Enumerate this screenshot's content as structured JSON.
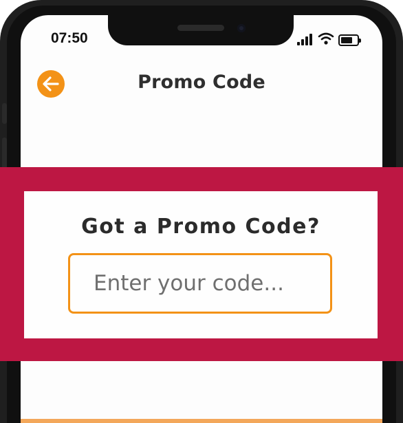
{
  "status_bar": {
    "time": "07:50",
    "icons": [
      "cellular-signal-icon",
      "wifi-icon",
      "battery-icon"
    ]
  },
  "nav": {
    "back_icon": "arrow-left-icon",
    "title": "Promo Code"
  },
  "promo": {
    "heading": "Got a Promo Code?",
    "input_placeholder": "Enter your code...",
    "input_value": ""
  },
  "colors": {
    "accent": "#f39217",
    "band": "#bd1743",
    "text": "#2b2b2b"
  }
}
